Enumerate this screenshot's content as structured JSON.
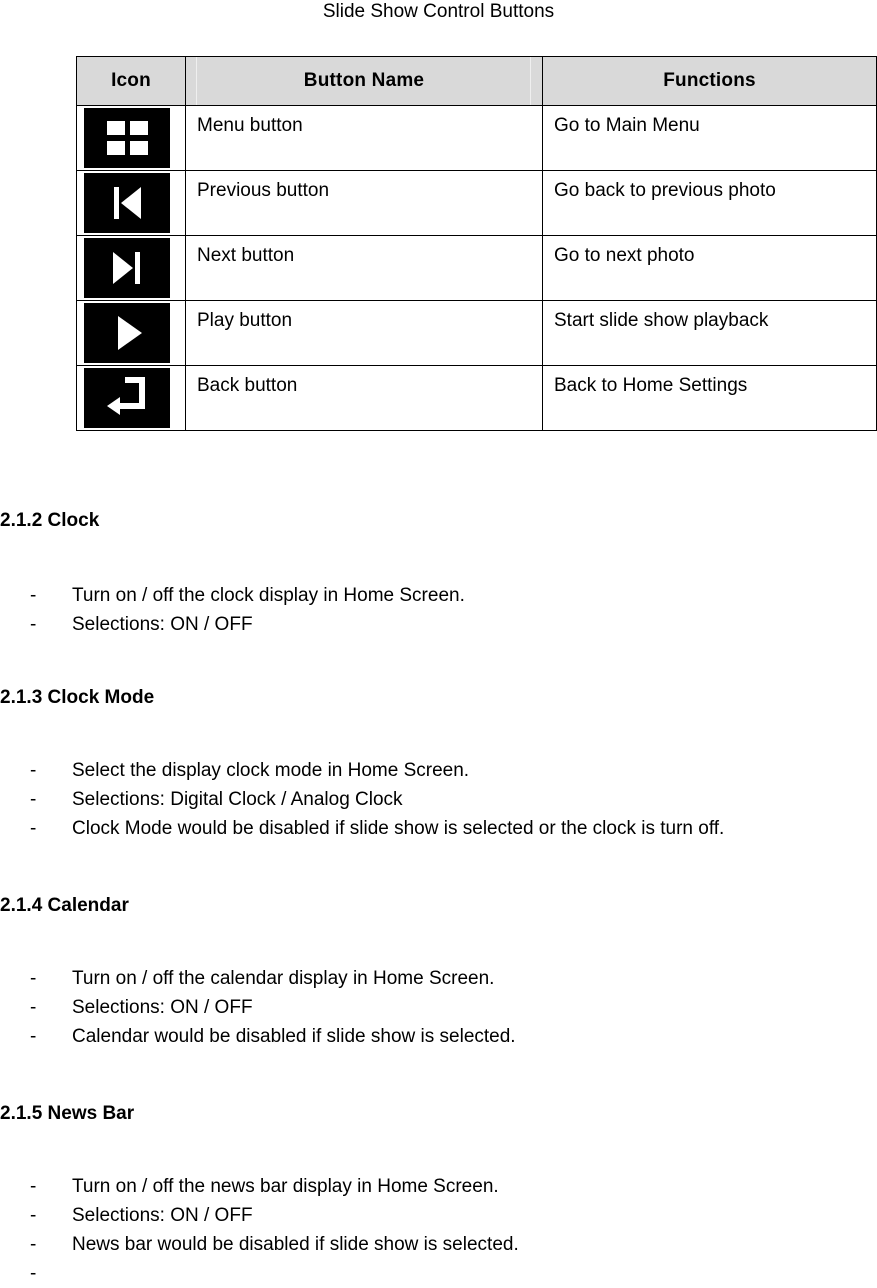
{
  "title": "Slide Show Control Buttons",
  "table": {
    "headers": {
      "icon": "Icon",
      "name": "Button Name",
      "functions": "Functions"
    },
    "rows": [
      {
        "icon": "menu-grid-icon",
        "name": "Menu button",
        "function": "Go to Main Menu"
      },
      {
        "icon": "previous-track-icon",
        "name": "Previous button",
        "function": "Go back to previous photo"
      },
      {
        "icon": "next-track-icon",
        "name": "Next button",
        "function": "Go to next photo"
      },
      {
        "icon": "play-icon",
        "name": "Play button",
        "function": "Start slide show playback"
      },
      {
        "icon": "return-arrow-icon",
        "name": "Back button",
        "function": "Back to Home Settings"
      }
    ]
  },
  "sections": [
    {
      "heading": "2.1.2 Clock",
      "bullets": [
        "Turn on / off the clock display in Home Screen.",
        "Selections: ON / OFF"
      ]
    },
    {
      "heading": "2.1.3 Clock Mode",
      "bullets": [
        "Select the display clock mode in Home Screen.",
        "Selections: Digital Clock / Analog Clock",
        "Clock Mode would be disabled if slide show is selected or the clock is turn off."
      ]
    },
    {
      "heading": "2.1.4 Calendar",
      "bullets": [
        "Turn on / off the calendar display in Home Screen.",
        "Selections: ON / OFF",
        "Calendar would be disabled if slide show is selected."
      ]
    },
    {
      "heading": "2.1.5 News Bar",
      "bullets": [
        "Turn on / off the news bar display in Home Screen.",
        "Selections: ON / OFF",
        "News bar would be disabled if slide show is selected.",
        ""
      ]
    }
  ],
  "bullet_marker": "-",
  "colors": {
    "header_fill": "#d9d9d9",
    "icon_fill": "#000000",
    "glyph": "#ffffff",
    "border": "#000000",
    "text": "#000000",
    "page": "#ffffff"
  }
}
